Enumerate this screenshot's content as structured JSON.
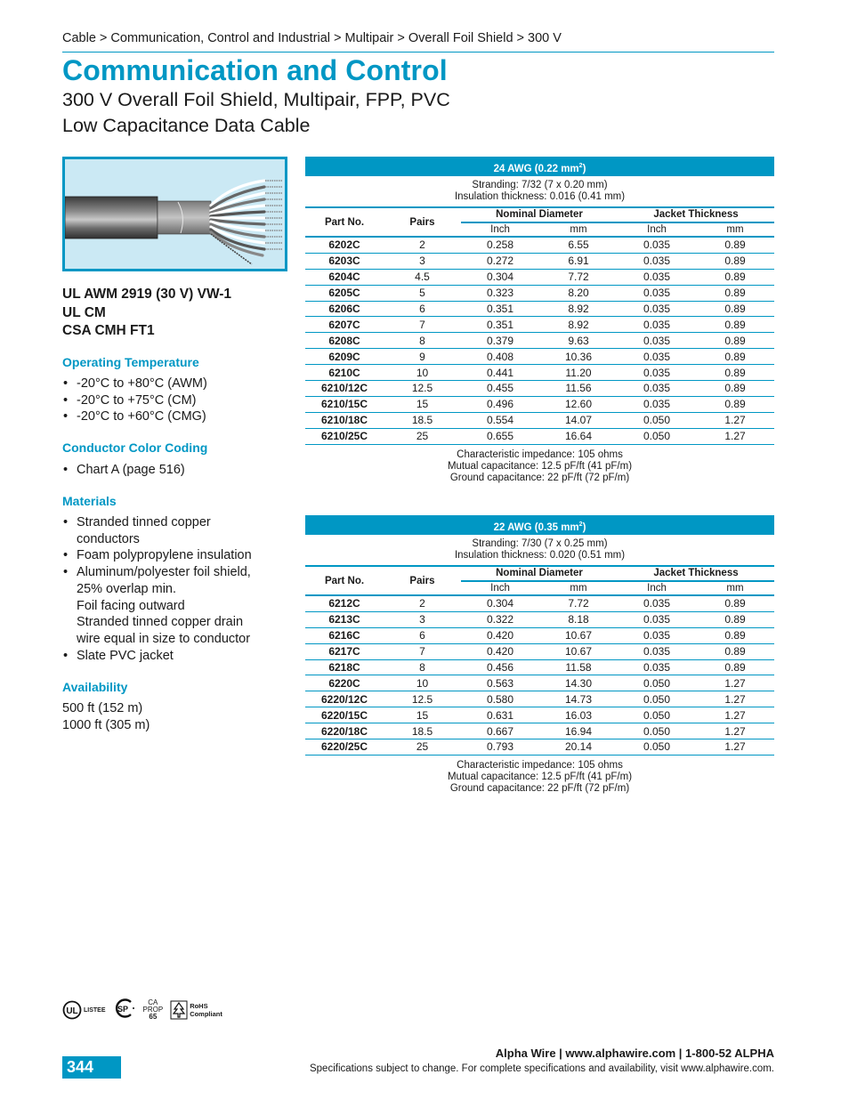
{
  "breadcrumb": "Cable > Communication, Control and Industrial > Multipair > Overall Foil Shield > 300 V",
  "title": "Communication and Control",
  "subtitle_line1": "300 V Overall Foil Shield, Multipair, FPP, PVC",
  "subtitle_line2": "Low Capacitance Data Cable",
  "product_image": {
    "alt": "Multipair cable with slate PVC jacket, foil shield and exposed twisted pairs"
  },
  "certifications": [
    "UL AWM 2919 (30 V) VW-1",
    "UL CM",
    "CSA CMH FT1"
  ],
  "sections": {
    "operating_temperature": {
      "heading": "Operating Temperature",
      "items": [
        "-20°C to +80°C (AWM)",
        "-20°C to +75°C (CM)",
        "-20°C to +60°C (CMG)"
      ]
    },
    "conductor_color_coding": {
      "heading": "Conductor Color Coding",
      "items": [
        "Chart A (page 516)"
      ]
    },
    "materials": {
      "heading": "Materials",
      "items": [
        {
          "lines": [
            "Stranded tinned copper",
            "conductors"
          ]
        },
        {
          "lines": [
            "Foam polypropylene insulation"
          ]
        },
        {
          "lines": [
            "Aluminum/polyester foil shield,",
            "25% overlap min.",
            "Foil facing outward",
            "Stranded tinned copper drain",
            "wire equal in size to conductor"
          ]
        },
        {
          "lines": [
            "Slate PVC jacket"
          ]
        }
      ]
    },
    "availability": {
      "heading": "Availability",
      "items": [
        "500 ft (152 m)",
        "1000 ft (305 m)"
      ]
    }
  },
  "bullet": "•",
  "table_headers": {
    "part_no": "Part No.",
    "pairs": "Pairs",
    "nominal_diameter": "Nominal Diameter",
    "jacket_thickness": "Jacket Thickness",
    "inch": "Inch",
    "mm": "mm"
  },
  "tables": [
    {
      "gauge": "24 AWG (0.22 mm",
      "gauge_sup": "2",
      "gauge_close": ")",
      "stranding": "Stranding: 7/32 (7 x 0.20 mm)",
      "insulation": "Insulation thickness: 0.016 (0.41 mm)",
      "rows": [
        [
          "6202C",
          "2",
          "0.258",
          "6.55",
          "0.035",
          "0.89"
        ],
        [
          "6203C",
          "3",
          "0.272",
          "6.91",
          "0.035",
          "0.89"
        ],
        [
          "6204C",
          "4.5",
          "0.304",
          "7.72",
          "0.035",
          "0.89"
        ],
        [
          "6205C",
          "5",
          "0.323",
          "8.20",
          "0.035",
          "0.89"
        ],
        [
          "6206C",
          "6",
          "0.351",
          "8.92",
          "0.035",
          "0.89"
        ],
        [
          "6207C",
          "7",
          "0.351",
          "8.92",
          "0.035",
          "0.89"
        ],
        [
          "6208C",
          "8",
          "0.379",
          "9.63",
          "0.035",
          "0.89"
        ],
        [
          "6209C",
          "9",
          "0.408",
          "10.36",
          "0.035",
          "0.89"
        ],
        [
          "6210C",
          "10",
          "0.441",
          "11.20",
          "0.035",
          "0.89"
        ],
        [
          "6210/12C",
          "12.5",
          "0.455",
          "11.56",
          "0.035",
          "0.89"
        ],
        [
          "6210/15C",
          "15",
          "0.496",
          "12.60",
          "0.035",
          "0.89"
        ],
        [
          "6210/18C",
          "18.5",
          "0.554",
          "14.07",
          "0.050",
          "1.27"
        ],
        [
          "6210/25C",
          "25",
          "0.655",
          "16.64",
          "0.050",
          "1.27"
        ]
      ],
      "notes": [
        "Characteristic impedance: 105 ohms",
        "Mutual capacitance: 12.5 pF/ft (41 pF/m)",
        "Ground capacitance: 22 pF/ft (72 pF/m)"
      ]
    },
    {
      "gauge": "22 AWG (0.35 mm",
      "gauge_sup": "2",
      "gauge_close": ")",
      "stranding": "Stranding: 7/30 (7 x 0.25 mm)",
      "insulation": "Insulation thickness: 0.020 (0.51 mm)",
      "rows": [
        [
          "6212C",
          "2",
          "0.304",
          "7.72",
          "0.035",
          "0.89"
        ],
        [
          "6213C",
          "3",
          "0.322",
          "8.18",
          "0.035",
          "0.89"
        ],
        [
          "6216C",
          "6",
          "0.420",
          "10.67",
          "0.035",
          "0.89"
        ],
        [
          "6217C",
          "7",
          "0.420",
          "10.67",
          "0.035",
          "0.89"
        ],
        [
          "6218C",
          "8",
          "0.456",
          "11.58",
          "0.035",
          "0.89"
        ],
        [
          "6220C",
          "10",
          "0.563",
          "14.30",
          "0.050",
          "1.27"
        ],
        [
          "6220/12C",
          "12.5",
          "0.580",
          "14.73",
          "0.050",
          "1.27"
        ],
        [
          "6220/15C",
          "15",
          "0.631",
          "16.03",
          "0.050",
          "1.27"
        ],
        [
          "6220/18C",
          "18.5",
          "0.667",
          "16.94",
          "0.050",
          "1.27"
        ],
        [
          "6220/25C",
          "25",
          "0.793",
          "20.14",
          "0.050",
          "1.27"
        ]
      ],
      "notes": [
        "Characteristic impedance: 105 ohms",
        "Mutual capacitance: 12.5 pF/ft (41 pF/m)",
        "Ground capacitance: 22 pF/ft (72 pF/m)"
      ]
    }
  ],
  "logos": {
    "ul": {
      "mark": "UL",
      "text": "LISTEE"
    },
    "csa": {
      "mark": "SP"
    },
    "prop65": {
      "line1": "CA",
      "line2": "PROP",
      "line3": "65"
    },
    "rohs": {
      "line1": "RoHS",
      "line2": "Compliant"
    }
  },
  "page_number": "344",
  "footer": {
    "contact": "Alpha Wire | www.alphawire.com | 1-800-52 ALPHA",
    "disclaimer": "Specifications subject to change. For complete specifications and availability, visit www.alphawire.com."
  },
  "colors": {
    "accent": "#0097c4",
    "photo_bg": "#cbe9f4",
    "text": "#1a1a1a"
  }
}
